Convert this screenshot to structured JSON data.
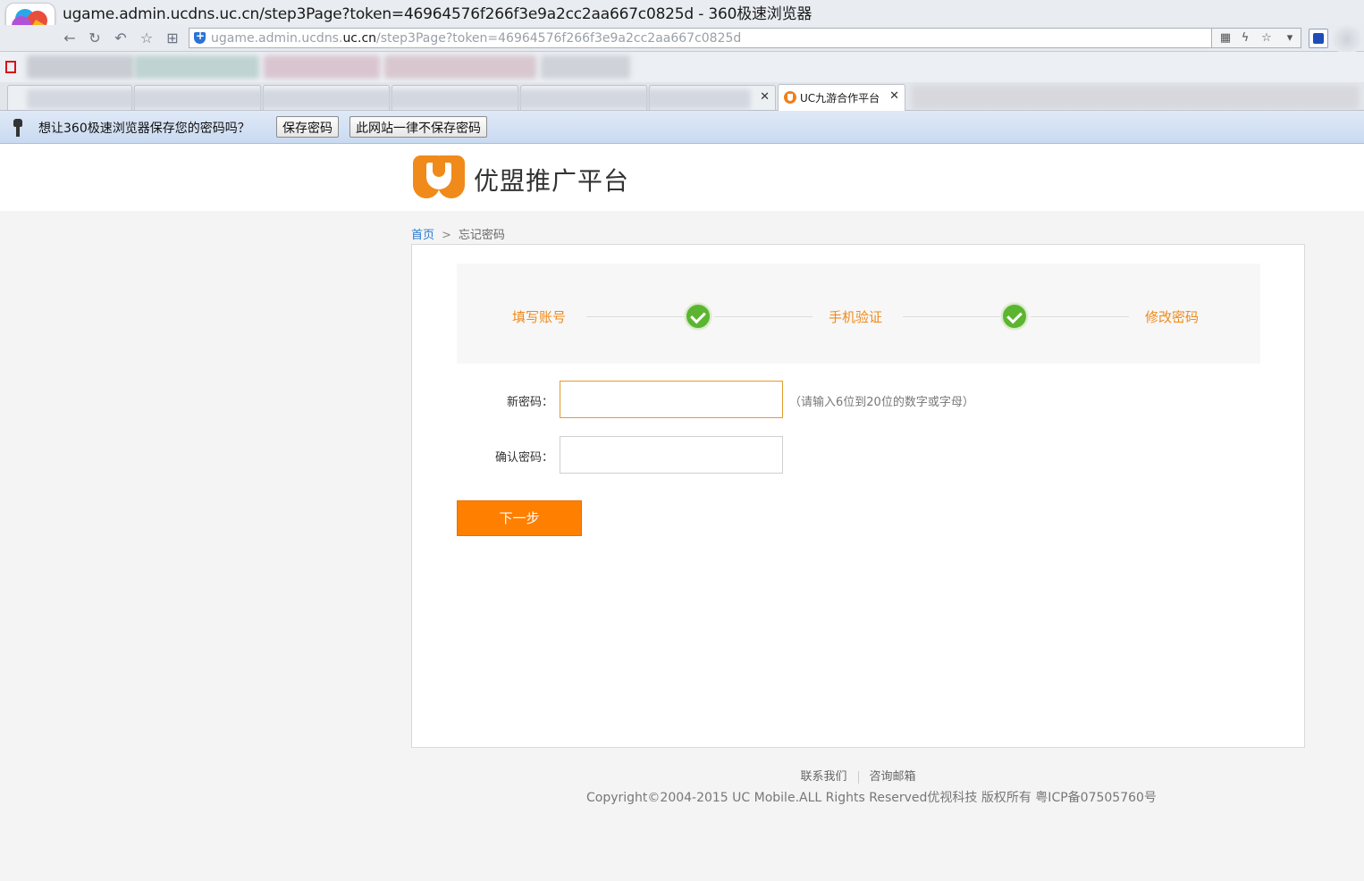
{
  "window": {
    "title": "ugame.admin.ucdns.uc.cn/step3Page?token=46964576f266f3e9a2cc2aa667c0825d - 360极速浏览器"
  },
  "address_bar": {
    "url_prefix": "ugame.admin.ucdns.",
    "url_domain": "uc.cn",
    "url_suffix": "/step3Page?token=46964576f266f3e9a2cc2aa667c0825d"
  },
  "tabs": {
    "active_label": "UC九游合作平台"
  },
  "password_prompt": {
    "message": "想让360极速浏览器保存您的密码吗？",
    "save_button": "保存密码",
    "never_button": "此网站一律不保存密码"
  },
  "site": {
    "logo_text": "优盟推广平台"
  },
  "breadcrumb": {
    "home": "首页",
    "separator": ">",
    "current": "忘记密码"
  },
  "steps": [
    {
      "label": "填写账号",
      "done": true
    },
    {
      "label": "手机验证",
      "done": true
    },
    {
      "label": "修改密码",
      "done": false
    }
  ],
  "form": {
    "new_password_label": "新密码：",
    "new_password_value": "",
    "new_password_hint": "（请输入6位到20位的数字或字母）",
    "confirm_password_label": "确认密码：",
    "confirm_password_value": "",
    "submit_label": "下一步"
  },
  "footer": {
    "contact": "联系我们",
    "email": "咨询邮箱",
    "copyright": "Copyright©2004-2015 UC Mobile.ALL Rights Reserved优视科技 版权所有 粤ICP备07505760号"
  },
  "colors": {
    "accent": "#ff7f00",
    "step_text": "#f08a1a",
    "check": "#5cb531",
    "link": "#2a7ad3"
  }
}
